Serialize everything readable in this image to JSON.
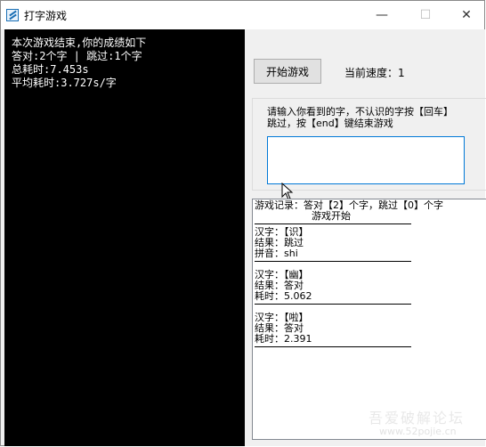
{
  "window": {
    "title": "打字游戏"
  },
  "titlebar": {
    "minimize": "—",
    "maximize": "☐",
    "close": "✕"
  },
  "console": {
    "lines": [
      "本次游戏结束,你的成绩如下",
      "答对:2个字 | 跳过:1个字",
      "总耗时:7.453s",
      "平均耗时:3.727s/字"
    ]
  },
  "controls": {
    "start_button": "开始游戏",
    "speed_label": "当前速度：1",
    "prompt_line1": "请输入你看到的字，不认识的字按【回车】",
    "prompt_line2": "跳过，按【end】键结束游戏",
    "input_value": ""
  },
  "log": {
    "header": "游戏记录：答对【2】个字，跳过【0】个字",
    "start": "游戏开始",
    "entries": [
      {
        "char": "汉字：【识】",
        "result": "结果：跳过",
        "extra": "拼音：shi"
      },
      {
        "char": "汉字：【幽】",
        "result": "结果：答对",
        "extra": "耗时：5.062"
      },
      {
        "char": "汉字：【啦】",
        "result": "结果：答对",
        "extra": "耗时：2.391"
      }
    ]
  },
  "watermark": {
    "text": "吾爱破解论坛",
    "url": "www.52pojie.cn"
  }
}
